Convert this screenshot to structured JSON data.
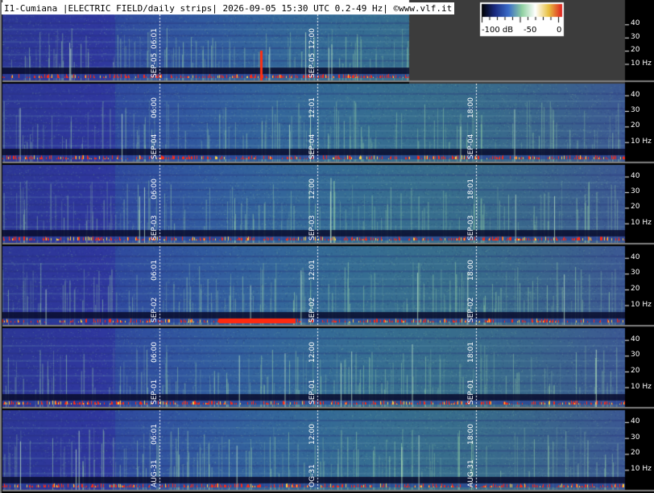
{
  "header": {
    "title": "I1-Cumiana |ELECTRIC FIELD/daily strips| 2026-09-05 15:30 UTC 0.2-49 Hz| ©www.vlf.it"
  },
  "colorbar": {
    "min_label": "-100 dB",
    "mid_label": "-50",
    "max_label": "0",
    "colors": [
      "#000000",
      "#1a2a80",
      "#3a6cc8",
      "#8fd0a0",
      "#ffffff",
      "#e8c040",
      "#e02020"
    ]
  },
  "frequency_axis_labels": [
    "40",
    "30",
    "20",
    "10 Hz"
  ],
  "colors": {
    "background_spectrogram": "#3b4fa0",
    "dark_band": "#0a0f30",
    "signal_green": "#9ed89a",
    "burst_red": "#ff2a10",
    "separator": "#808080",
    "empty_area": "#3c3c3c",
    "marker_line": "#ffffff"
  },
  "strips": [
    {
      "date": "SEP-05",
      "markers": [
        {
          "time": "06:01",
          "date_label": "SEP-05"
        },
        {
          "time": "12:00",
          "date_label": "SEP-05"
        }
      ]
    },
    {
      "date": "SEP-04",
      "markers": [
        {
          "time": "06:00",
          "date_label": "SEP-04"
        },
        {
          "time": "12:01",
          "date_label": "SEP-04"
        },
        {
          "time": "18:00",
          "date_label": "SEP-04"
        }
      ]
    },
    {
      "date": "SEP-03",
      "markers": [
        {
          "time": "06:00",
          "date_label": "SEP-03"
        },
        {
          "time": "12:00",
          "date_label": "SEP-03"
        },
        {
          "time": "18:01",
          "date_label": "SEP-03"
        }
      ]
    },
    {
      "date": "SEP-02",
      "markers": [
        {
          "time": "06:01",
          "date_label": "SEP-02"
        },
        {
          "time": "12:01",
          "date_label": "SEP-02"
        },
        {
          "time": "18:00",
          "date_label": "SEP-02"
        }
      ]
    },
    {
      "date": "SEP-01",
      "markers": [
        {
          "time": "06:00",
          "date_label": "SEP-01"
        },
        {
          "time": "12:00",
          "date_label": "SEP-01"
        },
        {
          "time": "18:01",
          "date_label": "SEP-01"
        }
      ]
    },
    {
      "date": "AUG-31",
      "markers": [
        {
          "time": "06:01",
          "date_label": "AUG-31"
        },
        {
          "time": "12:00",
          "date_label": "OG-31"
        },
        {
          "time": "18:00",
          "date_label": "AUG-31"
        }
      ]
    }
  ]
}
